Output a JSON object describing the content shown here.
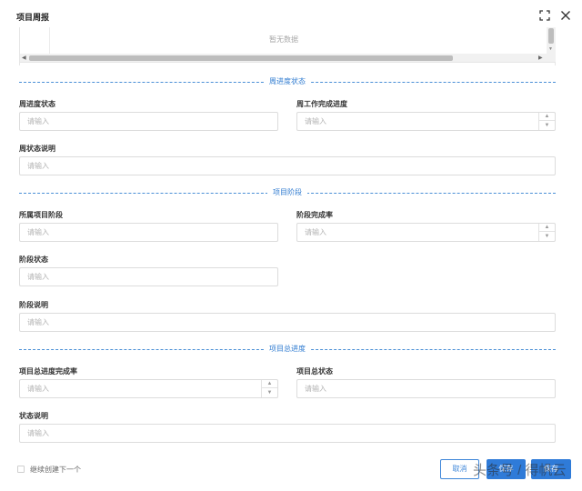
{
  "dialog": {
    "title": "项目周报"
  },
  "table": {
    "empty_text": "暂无数据"
  },
  "sections": {
    "week_progress": "周进度状态",
    "stage": "项目阶段",
    "overall": "项目总进度"
  },
  "fields": {
    "week_progress_status": {
      "label": "周进度状态",
      "placeholder": "请输入"
    },
    "week_work_completion": {
      "label": "周工作完成进度",
      "placeholder": "请输入"
    },
    "week_status_desc": {
      "label": "周状态说明",
      "placeholder": "请输入"
    },
    "project_stage": {
      "label": "所属项目阶段",
      "placeholder": "请输入"
    },
    "stage_completion_rate": {
      "label": "阶段完成率",
      "placeholder": "请输入"
    },
    "stage_status": {
      "label": "阶段状态",
      "placeholder": "请输入"
    },
    "stage_desc": {
      "label": "阶段说明",
      "placeholder": "请输入"
    },
    "overall_completion_rate": {
      "label": "项目总进度完成率",
      "placeholder": "请输入"
    },
    "overall_status": {
      "label": "项目总状态",
      "placeholder": "请输入"
    },
    "status_desc": {
      "label": "状态说明",
      "placeholder": "请输入"
    }
  },
  "footer": {
    "continue_label": "继续创建下一个",
    "cancel": "取消",
    "save": "保存",
    "save_next": "保存",
    "watermark": "头条号 / 得帆云"
  }
}
